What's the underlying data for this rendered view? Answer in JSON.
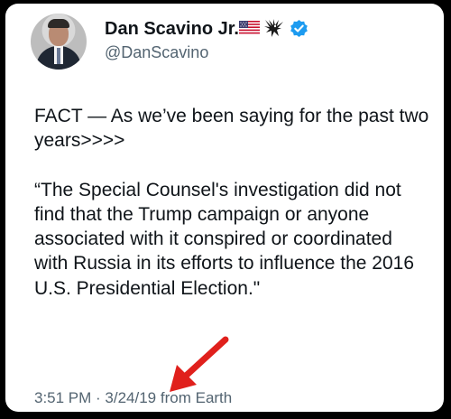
{
  "author": {
    "display_name": "Dan Scavino Jr.",
    "handle": "@DanScavino",
    "badges": [
      "us-flag-icon",
      "eagle-icon",
      "verified-icon"
    ]
  },
  "tweet": {
    "paragraph_1": "FACT — As we’ve been saying for the past two years>>>>",
    "paragraph_2": "“The Special Counsel's investigation did not find that the Trump campaign or anyone associated with it conspired or coordinated with Russia in its efforts to influence the 2016 U.S. Presidential Election.\""
  },
  "meta": {
    "time": "3:51 PM",
    "separator": " · ",
    "date": "3/24/19",
    "source": " from Earth"
  },
  "colors": {
    "background": "#000000",
    "card": "#ffffff",
    "text": "#0f1419",
    "secondary_text": "#536471",
    "verified": "#1d9bf0",
    "annotation_arrow": "#e0201c"
  }
}
